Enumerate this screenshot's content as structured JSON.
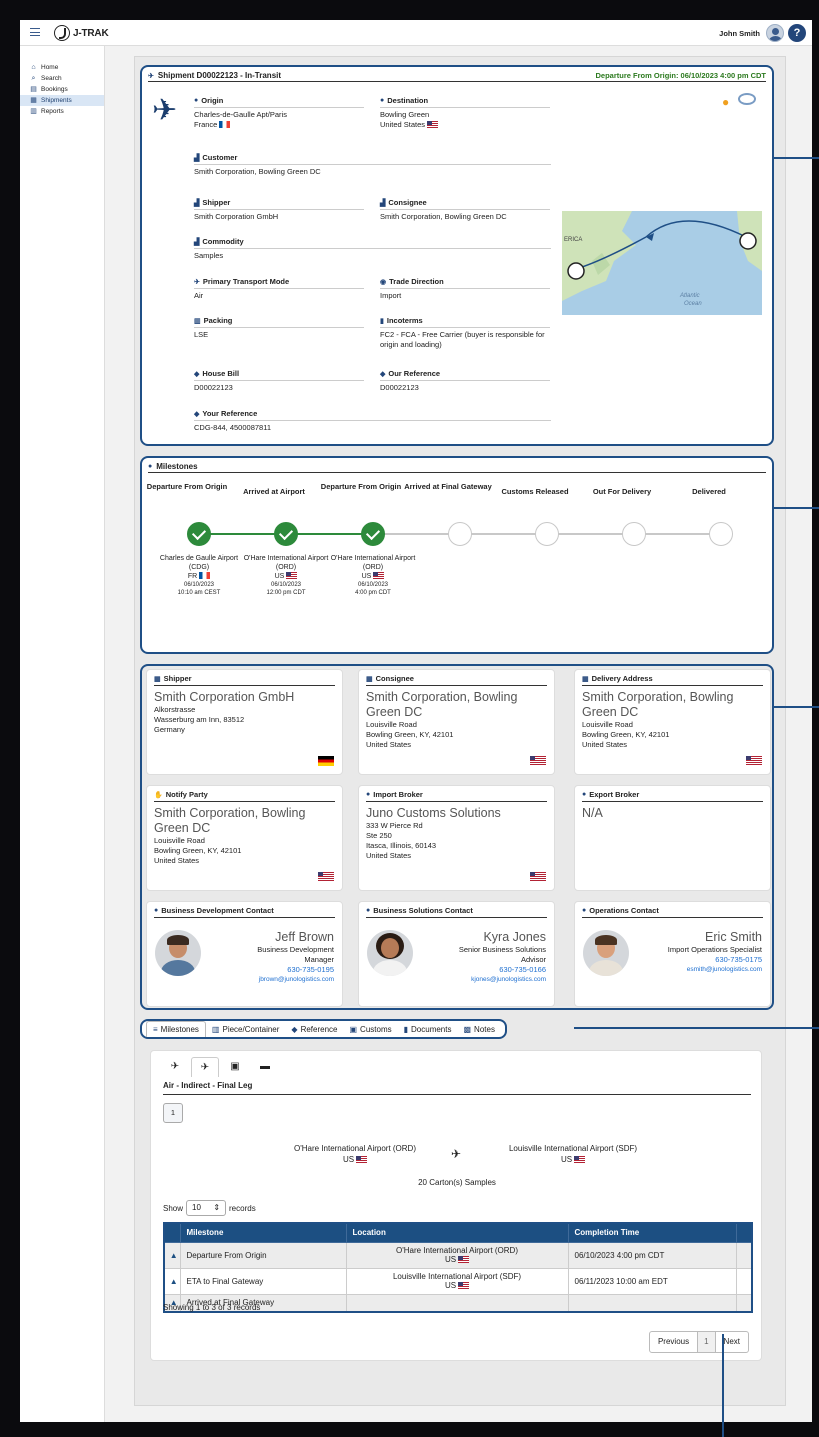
{
  "app": {
    "brand": "J-TRAK",
    "user_name": "John Smith",
    "help_label": "?"
  },
  "sidebar": {
    "items": [
      {
        "label": "Home",
        "icon": "home-icon"
      },
      {
        "label": "Search",
        "icon": "search-icon"
      },
      {
        "label": "Bookings",
        "icon": "bookings-icon"
      },
      {
        "label": "Shipments",
        "icon": "shipments-icon"
      },
      {
        "label": "Reports",
        "icon": "reports-icon"
      }
    ],
    "active": "Shipments"
  },
  "shipment": {
    "title": "Shipment D00022123 - In-Transit",
    "departure_status": "Departure From Origin: 06/10/2023 4:00 pm CDT",
    "fields": {
      "origin": {
        "label": "Origin",
        "value": "Charles-de-Gaulle Apt/Paris",
        "country": "France"
      },
      "destination": {
        "label": "Destination",
        "value": "Bowling Green",
        "country": "United States"
      },
      "customer": {
        "label": "Customer",
        "value": "Smith Corporation, Bowling Green DC"
      },
      "shipper": {
        "label": "Shipper",
        "value": "Smith Corporation GmbH"
      },
      "consignee": {
        "label": "Consignee",
        "value": "Smith Corporation, Bowling Green DC"
      },
      "commodity": {
        "label": "Commodity",
        "value": "Samples"
      },
      "transport_mode": {
        "label": "Primary Transport Mode",
        "value": "Air"
      },
      "trade_direction": {
        "label": "Trade Direction",
        "value": "Import"
      },
      "packing": {
        "label": "Packing",
        "value": "LSE"
      },
      "incoterms": {
        "label": "Incoterms",
        "value": "FC2 - FCA - Free Carrier (buyer is responsible for origin and loading)"
      },
      "house_bill": {
        "label": "House Bill",
        "value": "D00022123"
      },
      "our_reference": {
        "label": "Our Reference",
        "value": "D00022123"
      },
      "your_reference": {
        "label": "Your Reference",
        "value": "CDG-844, 4500087811"
      }
    },
    "map": {
      "label_left": "ERICA",
      "ocean_label_1": "Atlantic",
      "ocean_label_2": "Ocean"
    }
  },
  "milestones": {
    "title": "Milestones",
    "steps": [
      {
        "title": "Departure From Origin",
        "done": true,
        "location": "Charles de Gaulle Airport (CDG)",
        "country": "FR",
        "date": "06/10/2023",
        "time": "10:10 am CEST"
      },
      {
        "title": "Arrived at Airport",
        "done": true,
        "location": "O'Hare International Airport (ORD)",
        "country": "US",
        "date": "06/10/2023",
        "time": "12:00 pm CDT"
      },
      {
        "title": "Departure From Origin",
        "done": true,
        "location": "O'Hare International Airport (ORD)",
        "country": "US",
        "date": "06/10/2023",
        "time": "4:00 pm CDT"
      },
      {
        "title": "Arrived at Final Gateway",
        "done": false
      },
      {
        "title": "Customs Released",
        "done": false
      },
      {
        "title": "Out For Delivery",
        "done": false
      },
      {
        "title": "Delivered",
        "done": false
      }
    ]
  },
  "parties": {
    "shipper": {
      "title": "Shipper",
      "name": "Smith Corporation GmbH",
      "lines": [
        "Alkorstrasse",
        "Wasserburg am Inn, 83512",
        "Germany"
      ]
    },
    "consignee": {
      "title": "Consignee",
      "name": "Smith Corporation, Bowling Green DC",
      "lines": [
        "Louisville Road",
        "Bowling Green, KY, 42101",
        "United States"
      ]
    },
    "delivery": {
      "title": "Delivery Address",
      "name": "Smith Corporation, Bowling Green DC",
      "lines": [
        "Louisville Road",
        "Bowling Green, KY, 42101",
        "United States"
      ]
    },
    "notify": {
      "title": "Notify Party",
      "name": "Smith Corporation, Bowling Green DC",
      "lines": [
        "Louisville Road",
        "Bowling Green, KY, 42101",
        "United States"
      ]
    },
    "import_broker": {
      "title": "Import Broker",
      "name": "Juno Customs Solutions",
      "lines": [
        "333 W Pierce Rd",
        "Ste 250",
        "Itasca, Illinois, 60143",
        "United States"
      ]
    },
    "export_broker": {
      "title": "Export Broker",
      "name": "N/A"
    }
  },
  "contacts": {
    "bd": {
      "title": "Business Development Contact",
      "name": "Jeff Brown",
      "role_1": "Business Development",
      "role_2": "Manager",
      "phone": "630-735-0195",
      "email": "jbrown@junologistics.com"
    },
    "bs": {
      "title": "Business Solutions Contact",
      "name": "Kyra Jones",
      "role_1": "Senior Business Solutions",
      "role_2": "Advisor",
      "phone": "630-735-0166",
      "email": "kjones@junologistics.com"
    },
    "ops": {
      "title": "Operations Contact",
      "name": "Eric Smith",
      "role_1": "Import Operations Specialist",
      "phone": "630-735-0175",
      "email": "esmith@junologistics.com"
    }
  },
  "tabs": [
    {
      "label": "Milestones",
      "icon": "list-icon"
    },
    {
      "label": "Piece/Container",
      "icon": "container-icon"
    },
    {
      "label": "Reference",
      "icon": "tag-icon"
    },
    {
      "label": "Customs",
      "icon": "customs-icon"
    },
    {
      "label": "Documents",
      "icon": "document-icon"
    },
    {
      "label": "Notes",
      "icon": "notes-icon"
    }
  ],
  "leg": {
    "title": "Air - Indirect - Final Leg",
    "page": "1",
    "from": {
      "name": "O'Hare International Airport (ORD)",
      "country": "US"
    },
    "to": {
      "name": "Louisville International Airport (SDF)",
      "country": "US"
    },
    "cartons": "20 Carton(s) Samples",
    "show_label": "Show",
    "show_value": "10",
    "records_label": "records",
    "table": {
      "headers": [
        "Milestone",
        "Location",
        "Completion Time"
      ],
      "rows": [
        {
          "milestone": "Departure From Origin",
          "location": "O'Hare International Airport (ORD)",
          "country": "US",
          "time": "06/10/2023 4:00 pm CDT"
        },
        {
          "milestone": "ETA to Final Gateway",
          "location": "Louisville International Airport (SDF)",
          "country": "US",
          "time": "06/11/2023 10:00 am EDT"
        },
        {
          "milestone": "Arrived at Final Gateway",
          "location": "",
          "country": "",
          "time": ""
        }
      ]
    },
    "records_info": "Showing 1 to 3 of 3 records",
    "pager": {
      "prev": "Previous",
      "current": "1",
      "next": "Next"
    }
  }
}
